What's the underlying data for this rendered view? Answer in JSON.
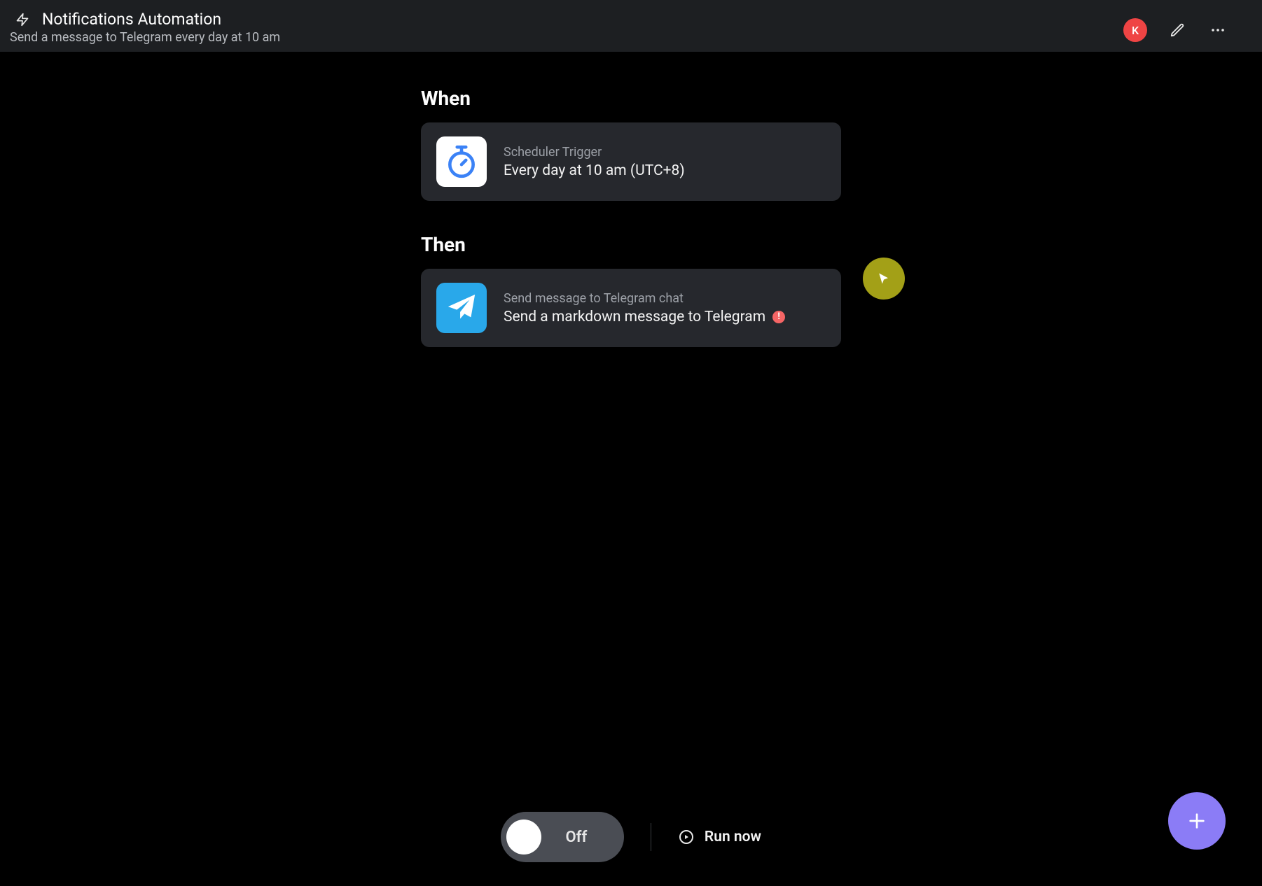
{
  "header": {
    "title": "Notifications Automation",
    "subtitle": "Send a message to Telegram every day at 10 am",
    "avatar_letter": "K"
  },
  "sections": {
    "when": {
      "label": "When",
      "card": {
        "type_label": "Scheduler Trigger",
        "description": "Every day at 10 am (UTC+8)"
      }
    },
    "then": {
      "label": "Then",
      "card": {
        "type_label": "Send message to Telegram chat",
        "description": "Send a markdown message to Telegram",
        "has_warning": true
      }
    }
  },
  "bottom": {
    "toggle_state": "Off",
    "run_label": "Run now"
  }
}
